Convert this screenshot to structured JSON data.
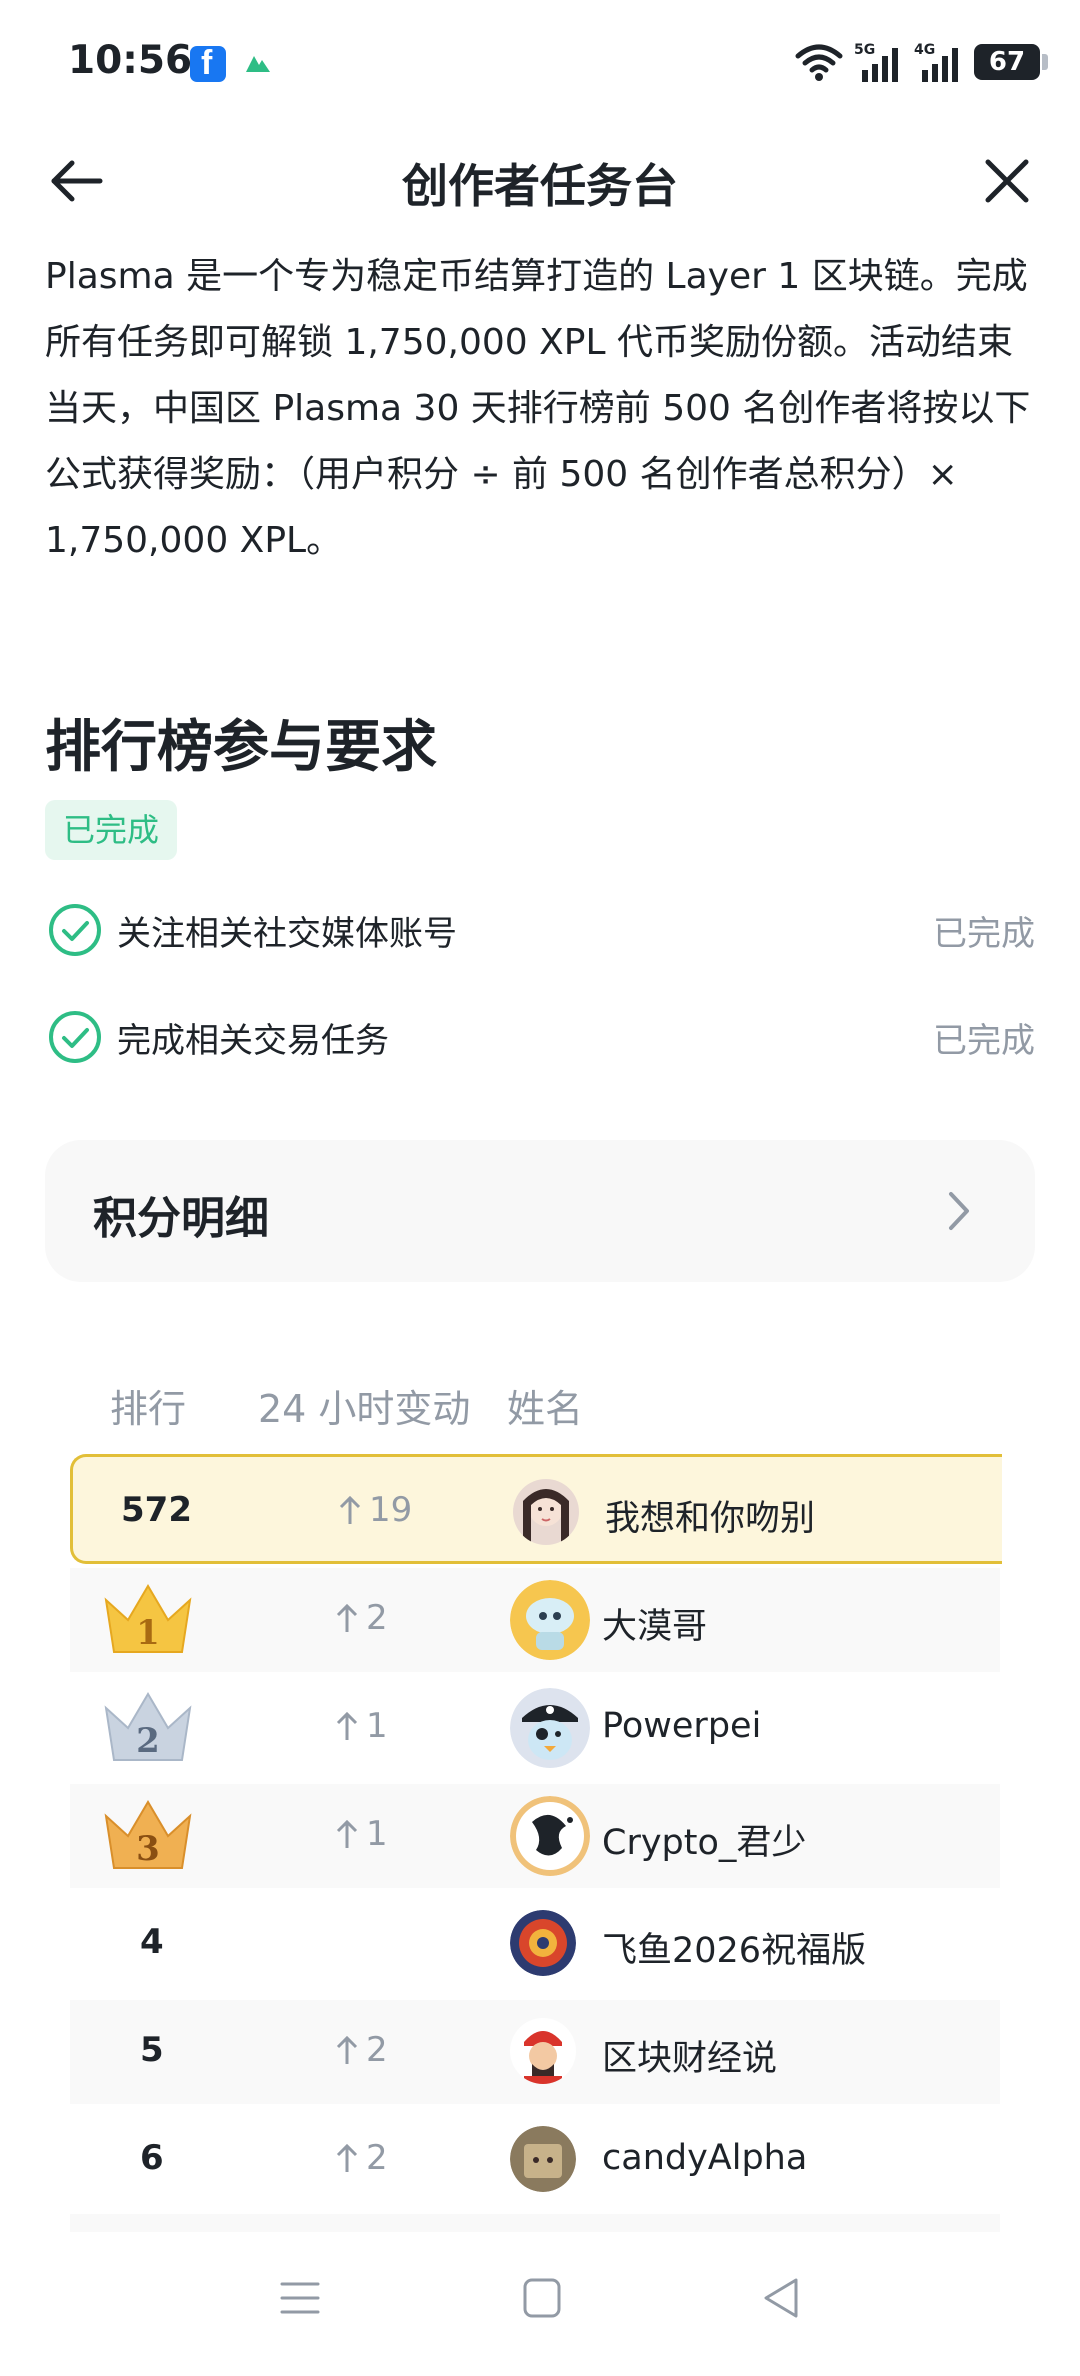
{
  "status_bar": {
    "time": "10:56",
    "battery": "67",
    "icons": [
      "facebook-icon",
      "app-notification-icon",
      "wifi-icon",
      "5g-signal-icon",
      "4g-signal-icon",
      "battery-icon"
    ]
  },
  "header": {
    "title": "创作者任务台",
    "back_icon": "arrow-left-icon",
    "close_icon": "close-icon"
  },
  "intro": {
    "text": "Plasma 是一个专为稳定币结算打造的 Layer 1 区块链。完成所有任务即可解锁 1,750,000 XPL 代币奖励份额。活动结束当天，中国区 Plasma 30 天排行榜前 500 名创作者将按以下公式获得奖励：（用户积分 ÷ 前 500 名创作者总积分）× 1,750,000 XPL。"
  },
  "requirements": {
    "title": "排行榜参与要求",
    "status_badge": "已完成",
    "items": [
      {
        "label": "关注相关社交媒体账号",
        "status": "已完成"
      },
      {
        "label": "完成相关交易任务",
        "status": "已完成"
      }
    ]
  },
  "points_detail": {
    "label": "积分明细"
  },
  "leaderboard": {
    "columns": [
      "排行",
      "24 小时变动",
      "姓名"
    ],
    "current_user": {
      "rank": "572",
      "change": "19",
      "name": "我想和你吻别"
    },
    "rows": [
      {
        "rank": "1",
        "change": "2",
        "name": "大漠哥"
      },
      {
        "rank": "2",
        "change": "1",
        "name": "Powerpei"
      },
      {
        "rank": "3",
        "change": "1",
        "name": "Crypto_君少"
      },
      {
        "rank": "4",
        "change": "",
        "name": "飞鱼2026祝福版"
      },
      {
        "rank": "5",
        "change": "2",
        "name": "区块财经说"
      },
      {
        "rank": "6",
        "change": "2",
        "name": "candyAlpha"
      }
    ]
  },
  "colors": {
    "accent_green": "#2ebd85",
    "highlight_bg": "#fdf6dc",
    "highlight_border": "#e2bf38",
    "muted_text": "#929aa5",
    "gold_crown": "#f5c542",
    "silver_crown": "#c9d3e0",
    "bronze_crown": "#f0b052"
  },
  "nav_bar": {
    "icons": [
      "menu-icon",
      "home-square-icon",
      "back-triangle-icon"
    ]
  }
}
